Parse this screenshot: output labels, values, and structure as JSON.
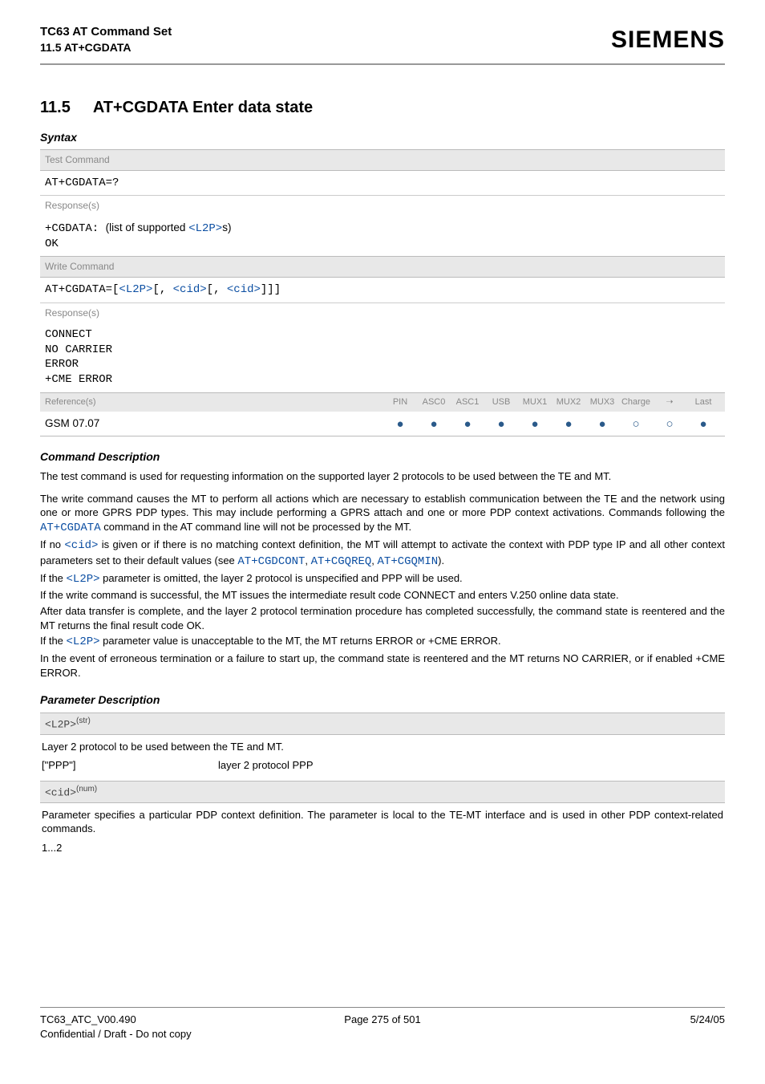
{
  "header": {
    "doc_title": "TC63 AT Command Set",
    "doc_sub": "11.5 AT+CGDATA",
    "brand": "SIEMENS"
  },
  "section": {
    "number": "11.5",
    "title": "AT+CGDATA   Enter data state"
  },
  "syntax": {
    "heading": "Syntax",
    "test_label": "Test Command",
    "test_cmd": "AT+CGDATA=?",
    "resp_label": "Response(s)",
    "test_resp_prefix": "+CGDATA: ",
    "test_resp_mid": "(list of supported ",
    "test_resp_link": "<L2P>",
    "test_resp_suffix": "s)",
    "test_resp_ok": "OK",
    "write_label": "Write Command",
    "write_cmd_prefix": "AT+CGDATA=[",
    "write_cmd_l2p": "<L2P>",
    "write_cmd_mid1": "[, ",
    "write_cmd_cid1": "<cid>",
    "write_cmd_mid2": "[, ",
    "write_cmd_cid2": "<cid>",
    "write_cmd_suffix": "]]]",
    "write_resp_lines": [
      "CONNECT",
      "NO CARRIER",
      "ERROR",
      "+CME ERROR"
    ]
  },
  "reference": {
    "label": "Reference(s)",
    "cols": [
      "PIN",
      "ASC0",
      "ASC1",
      "USB",
      "MUX1",
      "MUX2",
      "MUX3",
      "Charge",
      "➝",
      "Last"
    ],
    "row_label": "GSM 07.07",
    "values": [
      "●",
      "●",
      "●",
      "●",
      "●",
      "●",
      "●",
      "○",
      "○",
      "●"
    ]
  },
  "cmd_desc": {
    "heading": "Command Description",
    "p1": "The test command is used for requesting information on the supported layer 2 protocols to be used between the TE and MT.",
    "p2a": "The write command causes the MT to perform all actions which are necessary to establish communication between the TE and the network using one or more GPRS PDP types. This may include performing a GPRS attach and one or more PDP context activations. Commands following the ",
    "p2_link": "AT+CGDATA",
    "p2b": " command in the AT command line will not be processed by the MT.",
    "p3a": "If no ",
    "p3_link1": "<cid>",
    "p3b": " is given or if there is no matching context definition, the MT will attempt to activate the context with PDP type IP and all other context parameters set to their default values (see ",
    "p3_link2": "AT+CGDCONT",
    "p3c": ", ",
    "p3_link3": "AT+CGQREQ",
    "p3d": ", ",
    "p3_link4": "AT+CGQMIN",
    "p3e": ").",
    "p4a": "If the ",
    "p4_link": "<L2P>",
    "p4b": " parameter is omitted, the layer 2 protocol is unspecified and PPP will be used.",
    "p5": "If the write command is successful, the MT issues the intermediate result code CONNECT and enters V.250 online data state.",
    "p6": "After data transfer is complete, and the layer 2 protocol termination procedure has completed successfully, the command state is reentered and the MT returns the final result code OK.",
    "p7a": "If the ",
    "p7_link": "<L2P>",
    "p7b": " parameter value is unacceptable to the MT, the MT returns ERROR or +CME ERROR.",
    "p8": "In the event of erroneous termination or a failure to start up, the command state is reentered and the MT returns NO CARRIER, or if enabled +CME ERROR."
  },
  "param": {
    "heading": "Parameter Description",
    "l2p_name": "<L2P>",
    "l2p_type": "(str)",
    "l2p_desc": "Layer 2 protocol to be used between the TE and MT.",
    "l2p_key": "[\"PPP\"]",
    "l2p_val": "layer 2 protocol PPP",
    "cid_name": "<cid>",
    "cid_type": "(num)",
    "cid_desc": "Parameter specifies a particular PDP context definition. The parameter is local to the TE-MT interface and is used in other PDP context-related commands.",
    "cid_range": "1...2"
  },
  "footer": {
    "left1": "TC63_ATC_V00.490",
    "left2": "Confidential / Draft - Do not copy",
    "center": "Page 275 of 501",
    "right": "5/24/05"
  }
}
